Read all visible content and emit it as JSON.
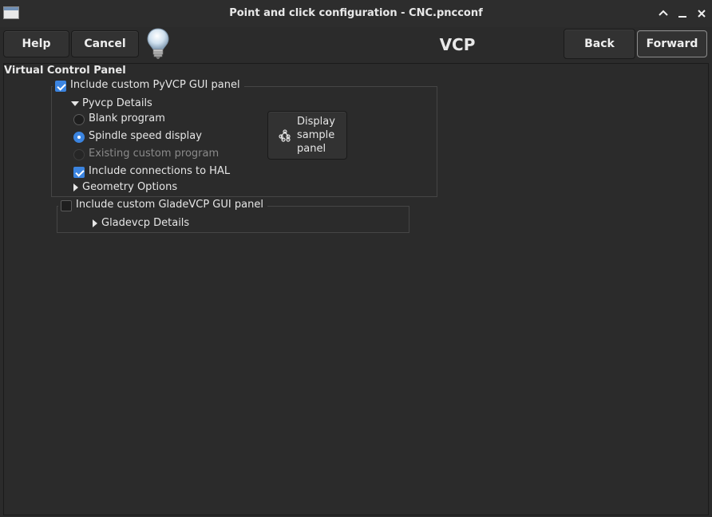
{
  "window": {
    "title": "Point and click configuration - CNC.pncconf",
    "minimize_glyph": "⌃",
    "restore_glyph": "‒",
    "close_glyph": "✕"
  },
  "toolbar": {
    "help_label": "Help",
    "cancel_label": "Cancel",
    "page_title": "VCP",
    "back_label": "Back",
    "forward_label": "Forward"
  },
  "panel": {
    "section_title": "Virtual Control Panel",
    "pyvcp": {
      "include_label": "Include custom PyVCP GUI panel",
      "include_checked": true,
      "details_label": "Pyvcp Details",
      "details_expanded": true,
      "options": [
        {
          "label": "Blank program",
          "selected": false,
          "enabled": true
        },
        {
          "label": "Spindle speed display",
          "selected": true,
          "enabled": true
        },
        {
          "label": "Existing custom program",
          "selected": false,
          "enabled": false
        }
      ],
      "hal_label": "Include connections to HAL",
      "hal_checked": true,
      "geometry_label": "Geometry Options",
      "sample_button": {
        "line1": "Display",
        "line2": "sample",
        "line3": "panel",
        "icon": "nodes-icon"
      }
    },
    "gladevcp": {
      "include_label": "Include custom GladeVCP GUI panel",
      "include_checked": false,
      "details_label": "Gladevcp Details",
      "details_expanded": false
    }
  },
  "colors": {
    "background": "#2b2b2b",
    "accent": "#3b84e0",
    "text": "#e6e6e6",
    "disabled_text": "#8a8a8a"
  }
}
